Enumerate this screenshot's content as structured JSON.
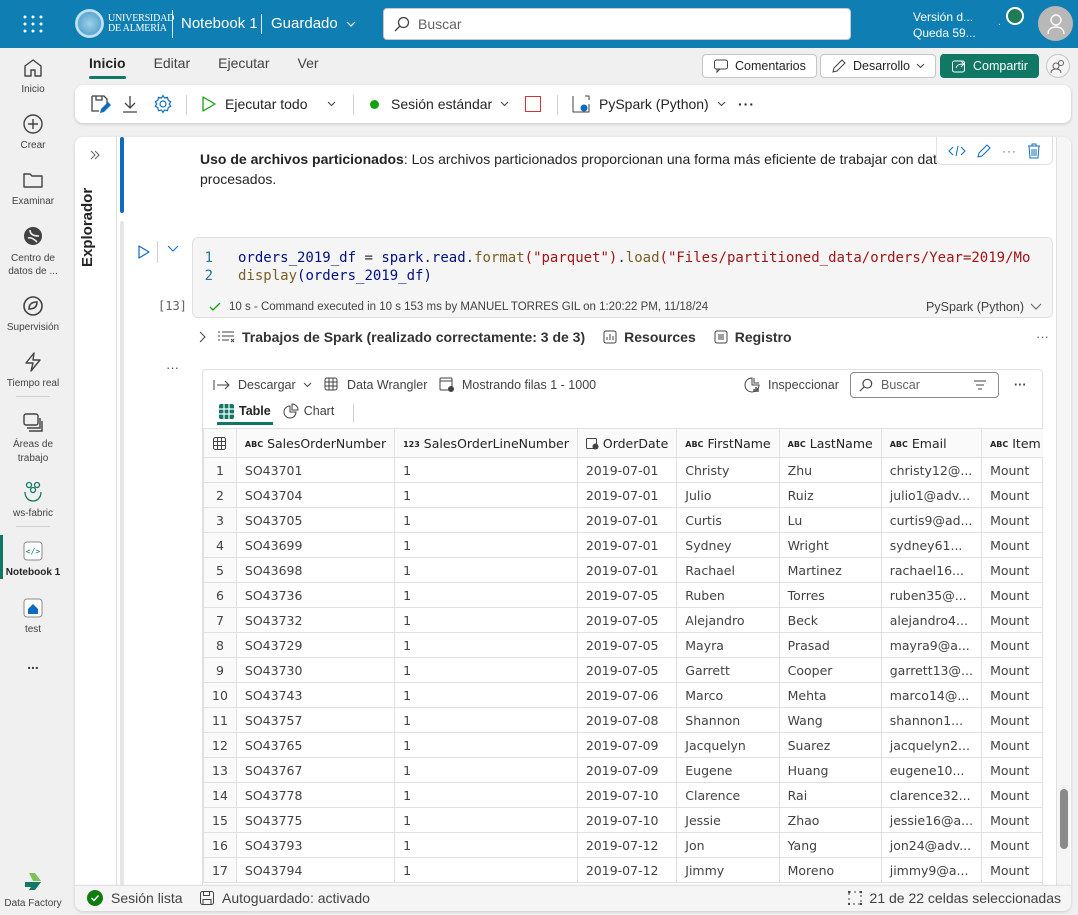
{
  "header": {
    "org_line1": "UNIVERSIDAD",
    "org_line2": "DE ALMERÍA",
    "notebook_title": "Notebook 1",
    "save_state": "Guardado",
    "search_placeholder": "Buscar",
    "version_line1": "Versión d...",
    "version_line2": "Queda 59..."
  },
  "rail": {
    "items": [
      {
        "label": "Inicio",
        "icon": "home-icon"
      },
      {
        "label": "Crear",
        "icon": "plus-circle-icon"
      },
      {
        "label": "Examinar",
        "icon": "folder-icon"
      },
      {
        "label": "Centro de datos de ...",
        "icon": "data-hub-icon"
      },
      {
        "label": "Supervisión",
        "icon": "monitor-icon"
      },
      {
        "label": "Tiempo real",
        "icon": "lightning-icon"
      },
      {
        "label": "Áreas de trabajo",
        "icon": "workspaces-icon"
      },
      {
        "label": "ws-fabric",
        "icon": "group-icon"
      },
      {
        "label": "Notebook 1",
        "icon": "notebook-icon"
      },
      {
        "label": "test",
        "icon": "lakehouse-icon"
      },
      {
        "label": "...",
        "icon": "more-icon"
      }
    ],
    "footer_label": "Data Factory"
  },
  "ribbon": {
    "tabs": [
      "Inicio",
      "Editar",
      "Ejecutar",
      "Ver"
    ],
    "active_tab": "Inicio",
    "comments_label": "Comentarios",
    "mode_label": "Desarrollo",
    "share_label": "Compartir",
    "run_all_label": "Ejecutar todo",
    "session_label": "Sesión estándar",
    "language_label": "PySpark (Python)",
    "session_color": "#13a10e",
    "accent_color": "#117865"
  },
  "explorer": {
    "title": "Explorador"
  },
  "markdown_cell": {
    "bold": "Uso de archivos particionados",
    "text": ": Los archivos particionados proporcionan una forma más eficiente de trabajar con datos procesados."
  },
  "code_cell": {
    "exec_count": "[13]",
    "lines": [
      {
        "n": "1",
        "var": "orders_2019_df",
        "op": " = ",
        "obj": "spark",
        "p1": ".",
        "m1": "read",
        "p2": ".",
        "fn1": "format",
        "a1": "(\"parquet\")",
        "p3": ".",
        "fn2": "load",
        "a2": "(\"Files/partitioned_data/orders/Year=2019/Mo"
      },
      {
        "n": "2",
        "fn": "display",
        "arg": "(orders_2019_df)"
      }
    ],
    "status": "10 s - Command executed in 10 s 153 ms by MANUEL TORRES GIL on 1:20:22 PM, 11/18/24",
    "language": "PySpark (Python)"
  },
  "spark_jobs": {
    "label": "Trabajos de Spark (realizado correctamente: 3 de 3)",
    "resources_label": "Resources",
    "log_label": "Registro"
  },
  "output": {
    "download_label": "Descargar",
    "wrangler_label": "Data Wrangler",
    "rows_label": "Mostrando filas 1 - 1000",
    "inspect_label": "Inspeccionar",
    "search_placeholder": "Buscar",
    "view_tabs": [
      "Table",
      "Chart"
    ],
    "active_view": "Table",
    "columns": [
      {
        "type": "ABC",
        "name": "SalesOrderNumber"
      },
      {
        "type": "123",
        "name": "SalesOrderLineNumber"
      },
      {
        "type": "date",
        "name": "OrderDate"
      },
      {
        "type": "ABC",
        "name": "FirstName"
      },
      {
        "type": "ABC",
        "name": "LastName"
      },
      {
        "type": "ABC",
        "name": "Email"
      },
      {
        "type": "ABC",
        "name": "Item"
      }
    ],
    "rows": [
      [
        "1",
        "SO43701",
        "1",
        "2019-07-01",
        "Christy",
        "Zhu",
        "christy12@...",
        "Mount"
      ],
      [
        "2",
        "SO43704",
        "1",
        "2019-07-01",
        "Julio",
        "Ruiz",
        "julio1@adv...",
        "Mount"
      ],
      [
        "3",
        "SO43705",
        "1",
        "2019-07-01",
        "Curtis",
        "Lu",
        "curtis9@ad...",
        "Mount"
      ],
      [
        "4",
        "SO43699",
        "1",
        "2019-07-01",
        "Sydney",
        "Wright",
        "sydney61...",
        "Mount"
      ],
      [
        "5",
        "SO43698",
        "1",
        "2019-07-01",
        "Rachael",
        "Martinez",
        "rachael16...",
        "Mount"
      ],
      [
        "6",
        "SO43736",
        "1",
        "2019-07-05",
        "Ruben",
        "Torres",
        "ruben35@...",
        "Mount"
      ],
      [
        "7",
        "SO43732",
        "1",
        "2019-07-05",
        "Alejandro",
        "Beck",
        "alejandro4...",
        "Mount"
      ],
      [
        "8",
        "SO43729",
        "1",
        "2019-07-05",
        "Mayra",
        "Prasad",
        "mayra9@a...",
        "Mount"
      ],
      [
        "9",
        "SO43730",
        "1",
        "2019-07-05",
        "Garrett",
        "Cooper",
        "garrett13@...",
        "Mount"
      ],
      [
        "10",
        "SO43743",
        "1",
        "2019-07-06",
        "Marco",
        "Mehta",
        "marco14@...",
        "Mount"
      ],
      [
        "11",
        "SO43757",
        "1",
        "2019-07-08",
        "Shannon",
        "Wang",
        "shannon1...",
        "Mount"
      ],
      [
        "12",
        "SO43765",
        "1",
        "2019-07-09",
        "Jacquelyn",
        "Suarez",
        "jacquelyn2...",
        "Mount"
      ],
      [
        "13",
        "SO43767",
        "1",
        "2019-07-09",
        "Eugene",
        "Huang",
        "eugene10...",
        "Mount"
      ],
      [
        "14",
        "SO43778",
        "1",
        "2019-07-10",
        "Clarence",
        "Rai",
        "clarence32...",
        "Mount"
      ],
      [
        "15",
        "SO43775",
        "1",
        "2019-07-10",
        "Jessie",
        "Zhao",
        "jessie16@a...",
        "Mount"
      ],
      [
        "16",
        "SO43793",
        "1",
        "2019-07-12",
        "Jon",
        "Yang",
        "jon24@adv...",
        "Mount"
      ],
      [
        "17",
        "SO43794",
        "1",
        "2019-07-12",
        "Jimmy",
        "Moreno",
        "jimmy9@a...",
        "Mount"
      ]
    ]
  },
  "statusbar": {
    "session": "Sesión lista",
    "autosave": "Autoguardado: activado",
    "cells_selected": "21 de 22 celdas seleccionadas"
  }
}
